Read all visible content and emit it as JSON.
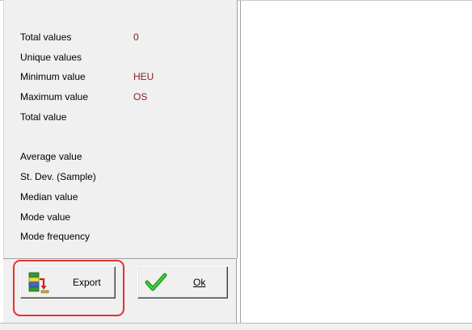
{
  "stats": {
    "rows": [
      {
        "label": "Total values",
        "value": "0"
      },
      {
        "label": "Unique values",
        "value": ""
      },
      {
        "label": "Minimum value",
        "value": "HEU"
      },
      {
        "label": "Maximum value",
        "value": "OS"
      },
      {
        "label": "Total value",
        "value": ""
      },
      {
        "label": "Average value",
        "value": ""
      },
      {
        "label": "St. Dev. (Sample)",
        "value": ""
      },
      {
        "label": "Median value",
        "value": ""
      },
      {
        "label": "Mode value",
        "value": ""
      },
      {
        "label": "Mode frequency",
        "value": ""
      }
    ]
  },
  "buttons": {
    "export_label": "Export",
    "export_icon": "export-table-icon",
    "ok_label": "Ok",
    "ok_icon": "green-checkmark-icon"
  },
  "colors": {
    "value_text": "#8b1a1a",
    "highlight": "#e8302c",
    "panel_bg": "#f0f0f0"
  }
}
